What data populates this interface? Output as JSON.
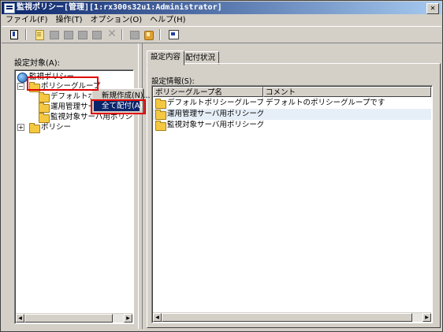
{
  "window": {
    "title": "監視ポリシー[管理][1:rx300s32u1:Administrator]",
    "close_glyph": "✕"
  },
  "menu": [
    "ファイル(F)",
    "操作(T)",
    "オプション(O)",
    "ヘルプ(H)"
  ],
  "toolbar": {
    "icons": [
      "open-icon",
      "new-policy-icon",
      "disabled-icon",
      "disabled-icon",
      "disabled-icon",
      "disabled-icon",
      "delete-icon",
      "disabled-icon",
      "distribute-icon",
      "properties-icon"
    ]
  },
  "left": {
    "label": "設定対象(A):",
    "tree": [
      {
        "label": "監視ポリシー",
        "icon": "globe-icon"
      },
      {
        "label": "ポリシーグループ",
        "icon": "folder-icon",
        "expander": "−"
      },
      {
        "label": "デフォルトポ",
        "icon": "folder-icon"
      },
      {
        "label": "運用管理サー",
        "icon": "folder-icon"
      },
      {
        "label": "監視対象サーバ用ポリシ",
        "icon": "folder-icon"
      },
      {
        "label": "ポリシー",
        "icon": "folder-icon",
        "expander": "+"
      }
    ],
    "scroll": {
      "left": "◀",
      "right": "▶"
    }
  },
  "context_menu": [
    {
      "label": "新規作成(N)..."
    },
    {
      "label": "全て配付(A)"
    }
  ],
  "right": {
    "tabs": [
      "設定内容",
      "配付状況"
    ],
    "info_label": "設定情報(S):",
    "columns": [
      "ポリシーグループ名",
      "コメント"
    ],
    "rows": [
      {
        "name": "デフォルトポリシーグループ",
        "comment": "デフォルトのポリシーグループです"
      },
      {
        "name": "運用管理サーバ用ポリシーグ...",
        "comment": ""
      },
      {
        "name": "監視対象サーバ用ポリシーグ...",
        "comment": ""
      }
    ],
    "scroll": {
      "left": "◀",
      "right": "▶"
    }
  },
  "colors": {
    "title_bar": "#0a246a",
    "highlight_box": "#e00000",
    "menu_selection": "#0a246a"
  }
}
